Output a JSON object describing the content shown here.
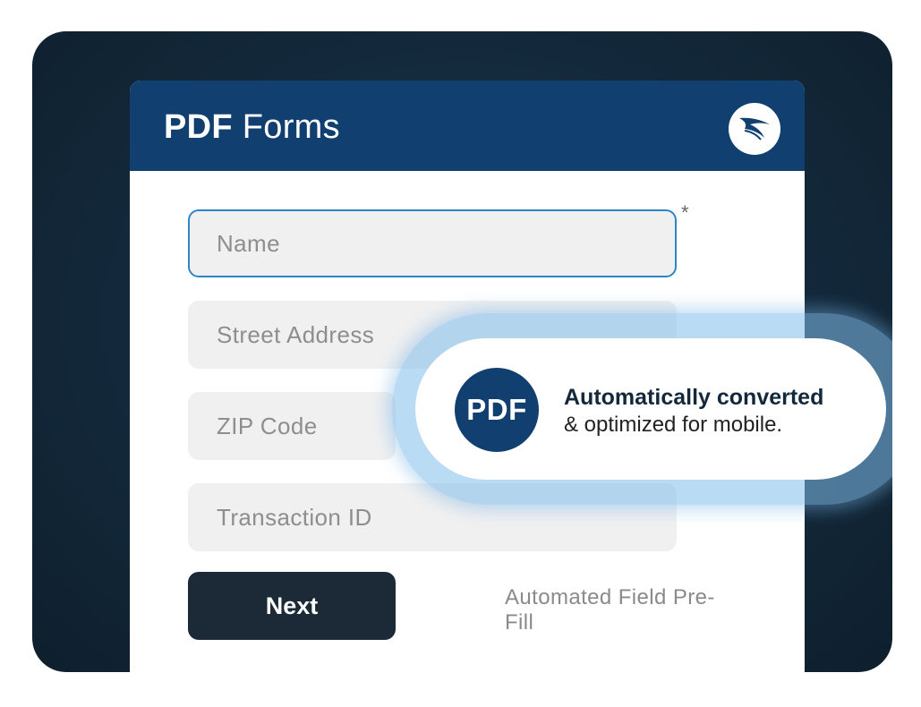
{
  "header": {
    "title_bold": "PDF",
    "title_rest": "Forms",
    "logo_icon": "paper-plane-icon"
  },
  "form": {
    "name_placeholder": "Name",
    "required_mark": "*",
    "street_placeholder": "Street Address",
    "zip_placeholder": "ZIP Code",
    "transaction_placeholder": "Transaction ID",
    "next_label": "Next",
    "prefill_note": "Automated Field Pre-Fill"
  },
  "callout": {
    "badge": "PDF",
    "headline": "Automatically converted",
    "subline": "& optimized for mobile."
  },
  "colors": {
    "header_bg": "#103f70",
    "stage_bg": "#13293b",
    "button_bg": "#1b2a36",
    "focus_border": "#2f86c6",
    "glow": "#82beeb"
  }
}
